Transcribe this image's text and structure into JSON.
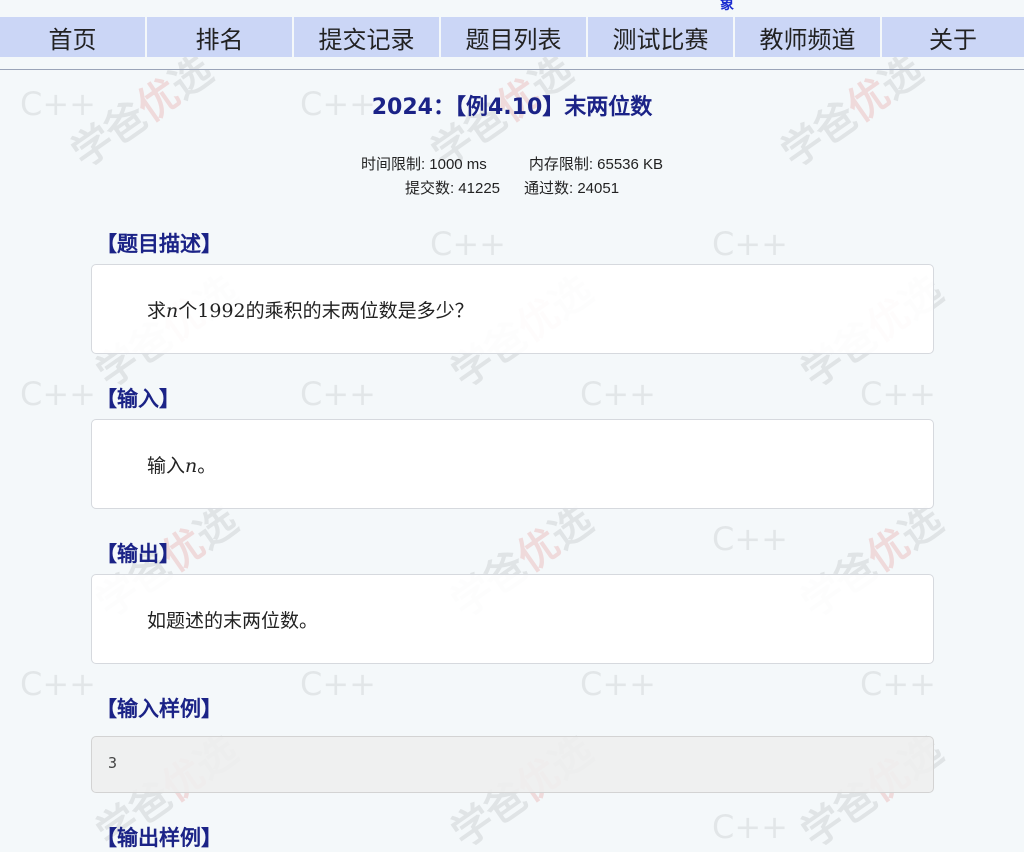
{
  "top_strip_text": "象",
  "nav": {
    "items": [
      "首页",
      "排名",
      "提交记录",
      "题目列表",
      "测试比赛",
      "教师频道",
      "关于"
    ]
  },
  "problem": {
    "title": "2024：【例4.10】末两位数",
    "time_limit_label": "时间限制: 1000 ms",
    "memory_limit_label": "内存限制: 65536 KB",
    "submissions_label": "提交数: 41225",
    "accepted_label": "通过数: 24051"
  },
  "sections": {
    "description": {
      "heading": "【题目描述】",
      "text_prefix": "求",
      "var": "n",
      "text_middle": "个",
      "number": "1992",
      "text_suffix": "的乘积的末两位数是多少？"
    },
    "input": {
      "heading": "【输入】",
      "text_prefix": "输入",
      "var": "n",
      "text_suffix": "。"
    },
    "output": {
      "heading": "【输出】",
      "text": "如题述的末两位数。"
    },
    "sample_input": {
      "heading": "【输入样例】",
      "value": "3"
    },
    "sample_output": {
      "heading": "【输出样例】"
    }
  },
  "watermark": {
    "text_a": "学爸",
    "text_b": "优",
    "text_c": "选",
    "text_cpp": "C++"
  },
  "colors": {
    "nav_bg": "#cbd6f6",
    "heading": "#1b2387",
    "page_bg": "#f4f8fa",
    "panel_border": "#d6d9de",
    "sample_bg": "#eeeeee"
  }
}
